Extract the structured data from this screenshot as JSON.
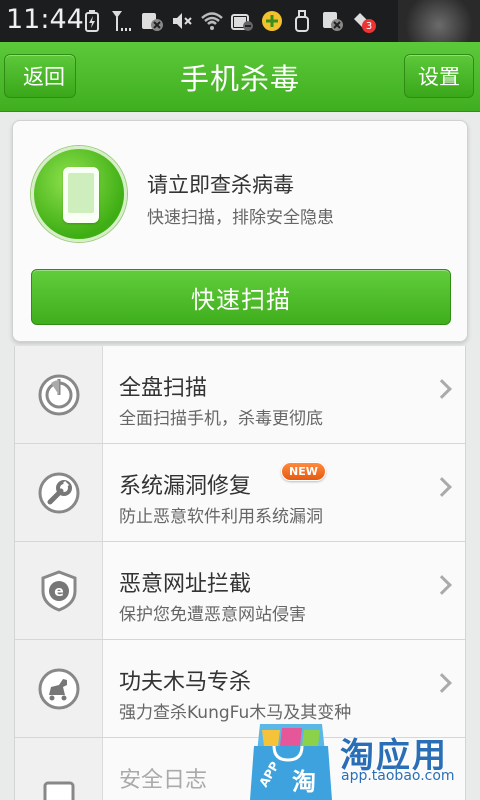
{
  "status_bar": {
    "time": "11:44",
    "icons": [
      "battery-charging-icon",
      "signal-icon",
      "sd-card-icon",
      "mute-icon",
      "wifi-icon",
      "battery-icon",
      "app-icon",
      "usb-icon",
      "scan-icon",
      "notification-icon"
    ],
    "notification_count": "3"
  },
  "header": {
    "back_label": "返回",
    "title": "手机杀毒",
    "settings_label": "设置"
  },
  "scan_card": {
    "title": "请立即查杀病毒",
    "subtitle": "快速扫描，排除安全隐患",
    "button_label": "快速扫描"
  },
  "features": [
    {
      "title": "全盘扫描",
      "subtitle": "全面扫描手机，杀毒更彻底",
      "icon": "full-scan-icon"
    },
    {
      "title": "系统漏洞修复",
      "subtitle": "防止恶意软件利用系统漏洞",
      "icon": "wrench-icon",
      "badge": "NEW"
    },
    {
      "title": "恶意网址拦截",
      "subtitle": "保护您免遭恶意网站侵害",
      "icon": "shield-e-icon"
    },
    {
      "title": "功夫木马专杀",
      "subtitle": "强力查杀KungFu木马及其变种",
      "icon": "trojan-horse-icon"
    },
    {
      "title": "安全日志",
      "subtitle": "",
      "icon": "log-icon"
    }
  ],
  "watermark": {
    "brand": "淘应用",
    "url": "app.taobao.com",
    "bag_label": "APP",
    "bag_char": "淘"
  },
  "colors": {
    "accent_green": "#4cb82a",
    "header_green": "#3fae1f",
    "badge_orange": "#f06a1c",
    "watermark_blue": "#2a6fb6"
  }
}
